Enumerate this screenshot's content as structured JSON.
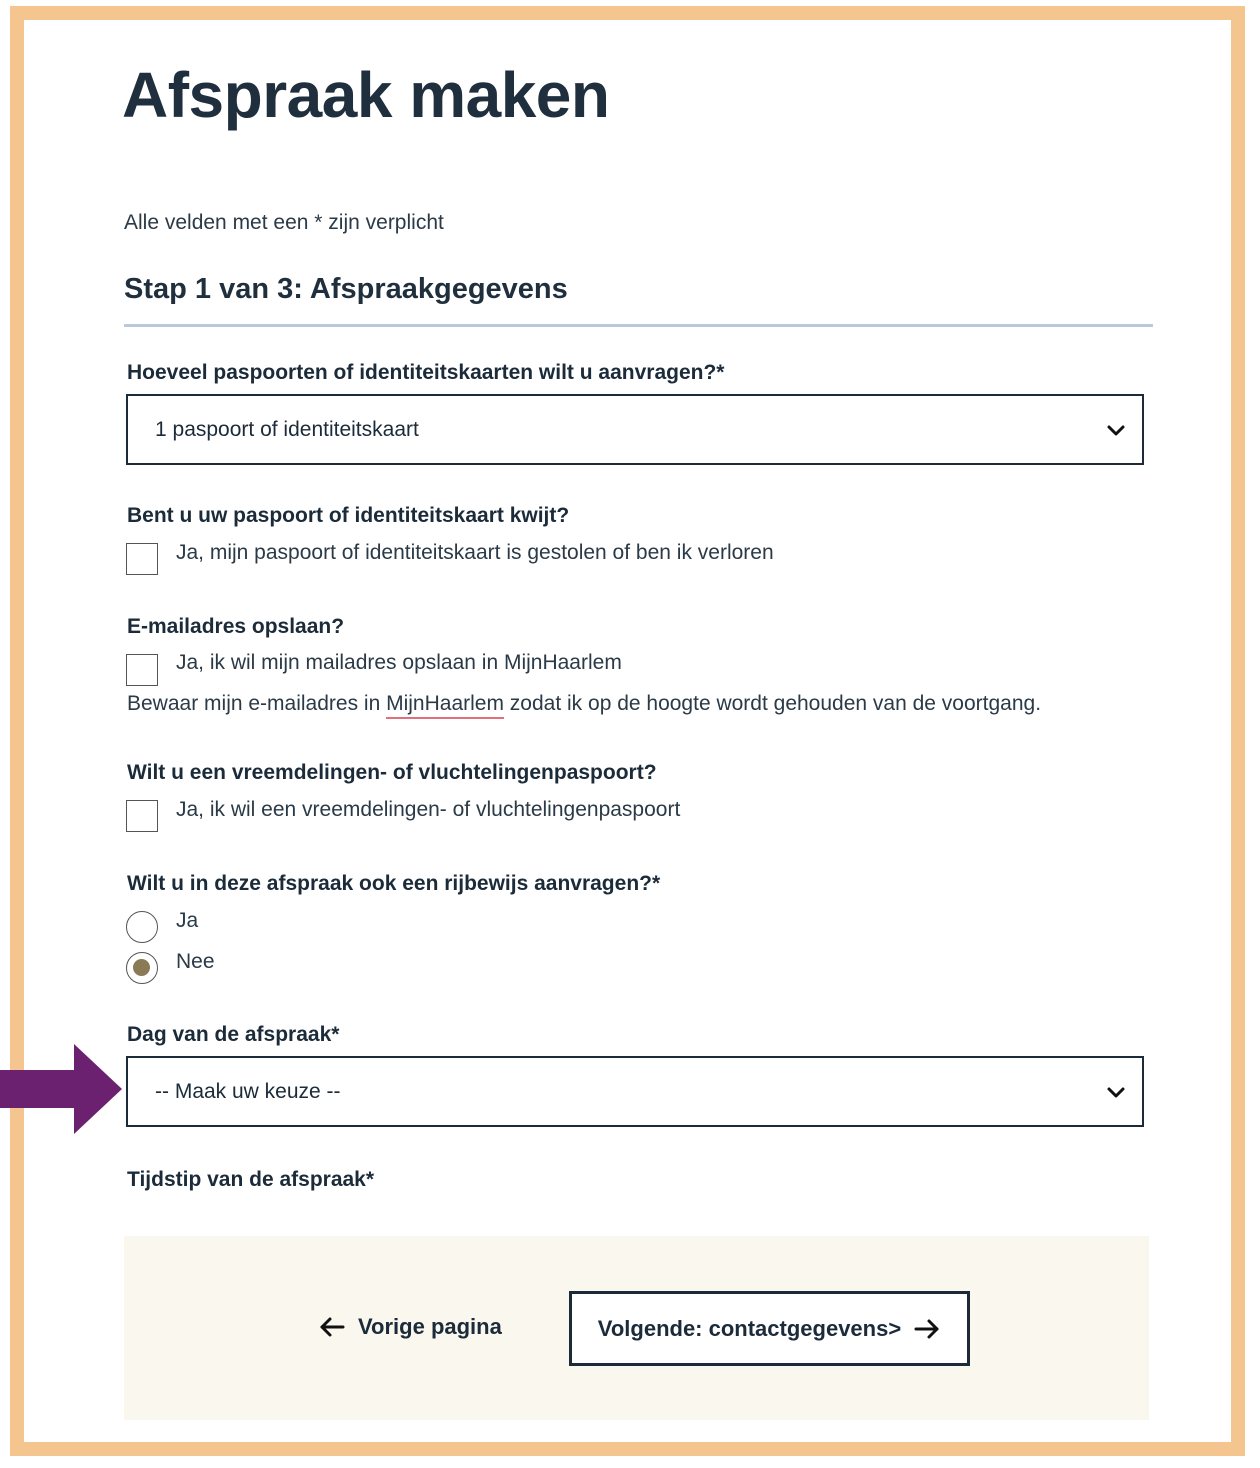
{
  "page": {
    "title": "Afspraak maken",
    "required_note": "Alle velden met een * zijn verplicht",
    "step_title": "Stap 1 van 3: Afspraakgegevens"
  },
  "form": {
    "q_quantity": {
      "label": "Hoeveel paspoorten of identiteitskaarten wilt u aanvragen?*",
      "selected": "1 paspoort of identiteitskaart"
    },
    "q_lost": {
      "label": "Bent u uw paspoort of identiteitskaart kwijt?",
      "option": "Ja, mijn paspoort of identiteitskaart is gestolen of ben ik verloren",
      "checked": false
    },
    "q_email": {
      "label": "E-mailadres opslaan?",
      "option": "Ja, ik wil mijn mailadres opslaan in MijnHaarlem",
      "checked": false,
      "help_before": "Bewaar mijn e-mailadres in ",
      "help_link": "MijnHaarlem",
      "help_after": " zodat ik op de hoogte wordt gehouden van de voortgang."
    },
    "q_foreign": {
      "label": "Wilt u een vreemdelingen- of vluchtelingenpaspoort?",
      "option": "Ja, ik wil een vreemdelingen- of vluchtelingenpaspoort",
      "checked": false
    },
    "q_license": {
      "label": "Wilt u in deze afspraak ook een rijbewijs aanvragen?*",
      "options": [
        "Ja",
        "Nee"
      ],
      "selected": "Nee"
    },
    "q_day": {
      "label": "Dag van de afspraak*",
      "selected": "-- Maak uw keuze --"
    },
    "q_time": {
      "label": "Tijdstip van de afspraak*"
    }
  },
  "nav": {
    "prev_label": "Vorige pagina",
    "next_label": "Volgende: contactgegevens>"
  },
  "colors": {
    "frame": "#f4c58e",
    "pointer_arrow": "#6b2170",
    "radio_fill": "#8a7a55",
    "nav_panel": "#faf7ee"
  }
}
